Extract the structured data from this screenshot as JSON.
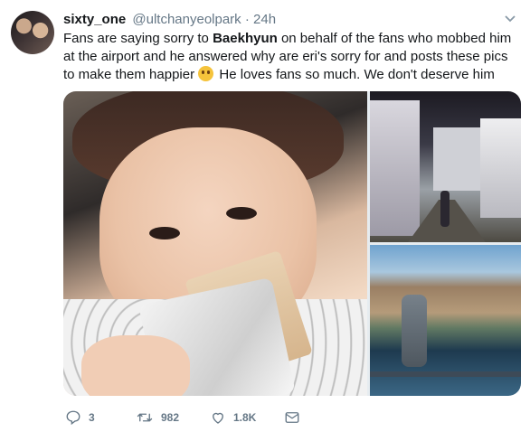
{
  "tweet": {
    "display_name": "sixty_one",
    "handle": "@ultchanyeolpark",
    "separator": "·",
    "time": "24h",
    "text_before": "Fans are saying sorry to ",
    "text_bold": "Baekhyun",
    "text_after": " on behalf of the fans who mobbed him at the airport and he answered why are eri's sorry for and posts these pics to make them happier",
    "text_end": " He loves fans so much. We don't deserve him",
    "emoji": "face-screaming-emoji",
    "media": [
      "main-selfie-photo",
      "street-photo",
      "lake-photo"
    ]
  },
  "actions": {
    "reply_count": "3",
    "retweet_count": "982",
    "like_count": "1.8K"
  },
  "icons": {
    "caret": "chevron-down-icon",
    "reply": "reply-icon",
    "retweet": "retweet-icon",
    "like": "heart-icon",
    "dm": "message-icon"
  },
  "colors": {
    "muted": "#657786",
    "text": "#14171a"
  }
}
